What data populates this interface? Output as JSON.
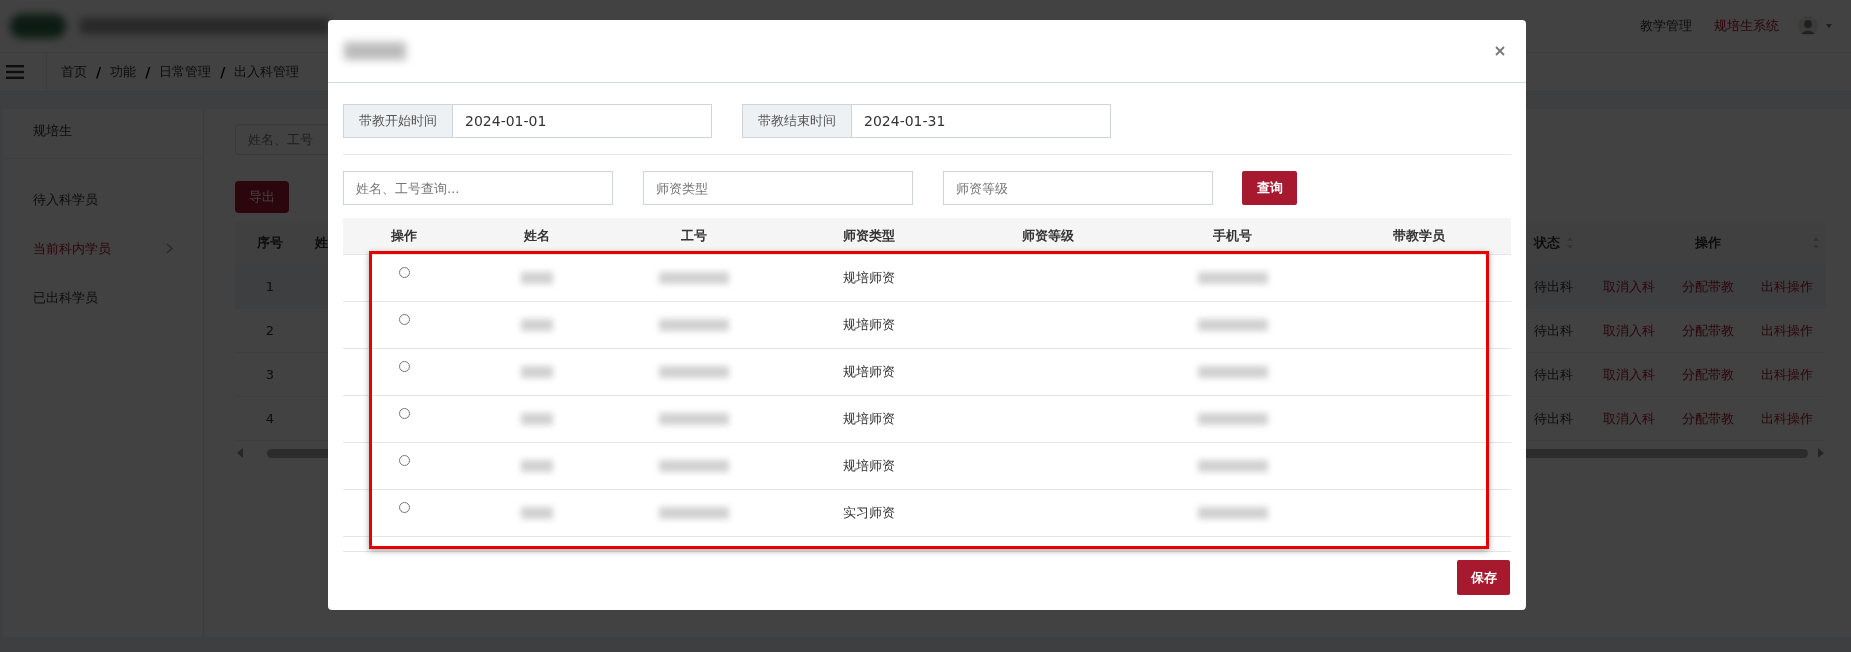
{
  "top_bar": {
    "menu_items": [
      {
        "label": "教学管理",
        "selected": false
      },
      {
        "label": "规培生系统",
        "selected": true
      }
    ]
  },
  "breadcrumb": {
    "separator": "/",
    "items": [
      "首页",
      "功能",
      "日常管理",
      "出入科管理"
    ]
  },
  "sidebar": {
    "title": "规培生",
    "items": [
      {
        "label": "待入科学员",
        "selected": false,
        "expandable": false
      },
      {
        "label": "当前科内学员",
        "selected": true,
        "expandable": true
      },
      {
        "label": "已出科学员",
        "selected": false,
        "expandable": false
      }
    ]
  },
  "main": {
    "search": {
      "placeholder": "姓名、工号"
    },
    "export_button": "导出",
    "table": {
      "columns": [
        "序号",
        "姓",
        "状态",
        "操作"
      ],
      "rows": [
        {
          "index": "1",
          "status": "待出科",
          "actions": [
            "取消入科",
            "分配带教",
            "出科操作"
          ]
        },
        {
          "index": "2",
          "status": "待出科",
          "actions": [
            "取消入科",
            "分配带教",
            "出科操作"
          ]
        },
        {
          "index": "3",
          "status": "待出科",
          "actions": [
            "取消入科",
            "分配带教",
            "出科操作"
          ]
        },
        {
          "index": "4",
          "status": "待出科",
          "actions": [
            "取消入科",
            "分配带教",
            "出科操作"
          ]
        }
      ]
    }
  },
  "dialog": {
    "date_range": [
      {
        "label": "带教开始时间",
        "value": "2024-01-01"
      },
      {
        "label": "带教结束时间",
        "value": "2024-01-31"
      }
    ],
    "filters": [
      {
        "placeholder": "姓名、工号查询..."
      },
      {
        "placeholder": "师资类型"
      },
      {
        "placeholder": "师资等级"
      }
    ],
    "search_button": "查询",
    "table": {
      "highlighted": true,
      "columns": [
        "操作",
        "姓名",
        "工号",
        "师资类型",
        "师资等级",
        "手机号",
        "带教学员"
      ],
      "rows": [
        {
          "selected": false,
          "type": "规培师资"
        },
        {
          "selected": false,
          "type": "规培师资"
        },
        {
          "selected": false,
          "type": "规培师资"
        },
        {
          "selected": false,
          "type": "规培师资"
        },
        {
          "selected": false,
          "type": "规培师资"
        },
        {
          "selected": false,
          "type": "实习师资"
        }
      ]
    },
    "save_button": "保存"
  }
}
